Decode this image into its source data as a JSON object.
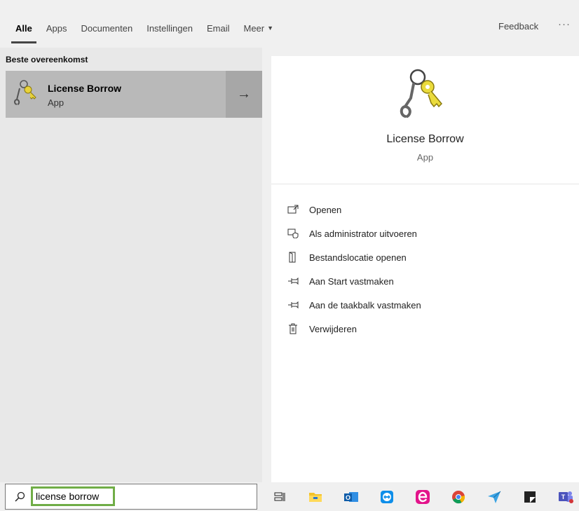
{
  "tabs": [
    {
      "label": "Alle",
      "active": true
    },
    {
      "label": "Apps"
    },
    {
      "label": "Documenten"
    },
    {
      "label": "Instellingen"
    },
    {
      "label": "Email"
    }
  ],
  "more_tab": {
    "label": "Meer",
    "icon": "chevron-down-icon"
  },
  "feedback_label": "Feedback",
  "more_menu_label": "···",
  "best_match": {
    "section_label": "Beste overeenkomst",
    "title": "License Borrow",
    "subtitle": "App",
    "icon": "keys-wrench-icon",
    "arrow": "→"
  },
  "detail": {
    "title": "License Borrow",
    "subtitle": "App",
    "actions": [
      {
        "label": "Openen",
        "icon": "open-icon"
      },
      {
        "label": "Als administrator uitvoeren",
        "icon": "admin-shield-icon"
      },
      {
        "label": "Bestandslocatie openen",
        "icon": "file-location-icon"
      },
      {
        "label": "Aan Start vastmaken",
        "icon": "pin-icon"
      },
      {
        "label": "Aan de taakbalk vastmaken",
        "icon": "pin-icon"
      },
      {
        "label": "Verwijderen",
        "icon": "trash-icon"
      }
    ]
  },
  "search": {
    "value": "license borrow",
    "highlight_color": "#70ad47"
  },
  "taskbar": [
    "task-view-icon",
    "file-explorer-icon",
    "outlook-icon",
    "teamviewer-icon",
    "e-app-icon",
    "chrome-icon",
    "send-icon",
    "sticky-app-icon",
    "teams-icon"
  ]
}
